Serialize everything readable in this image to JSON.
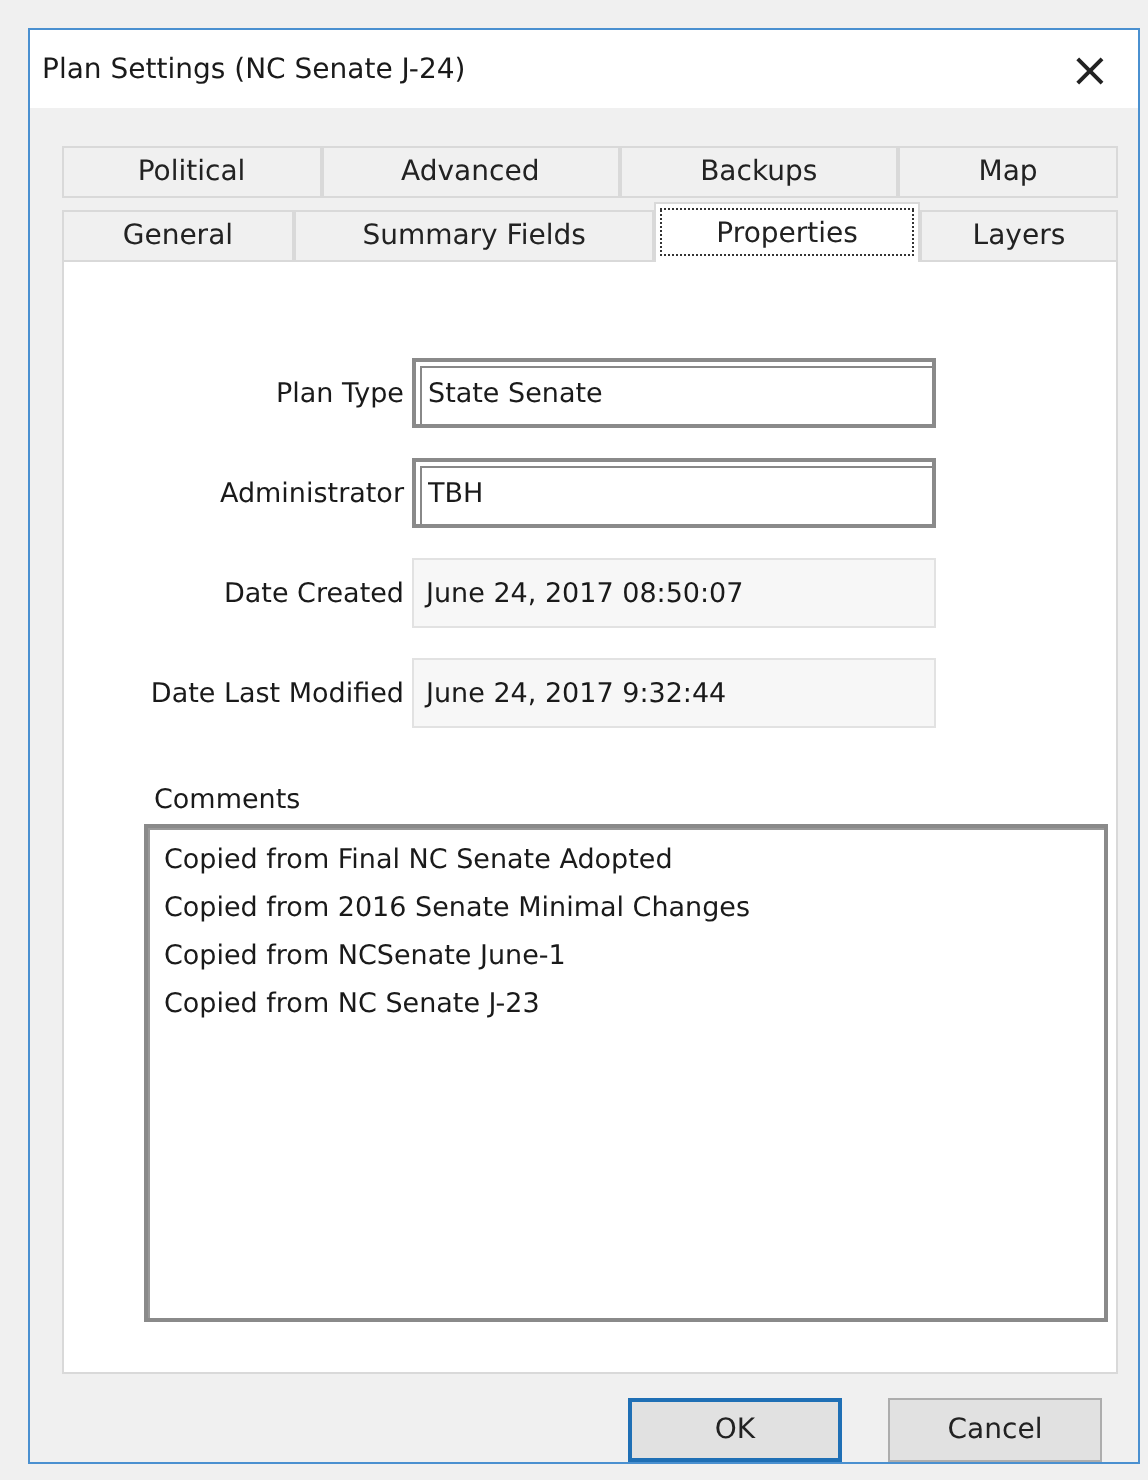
{
  "window": {
    "title": "Plan Settings (NC Senate J-24)",
    "close": "×"
  },
  "tab_rows": [
    [
      {
        "label": "Political",
        "selected": false
      },
      {
        "label": "Advanced",
        "selected": false
      },
      {
        "label": "Backups",
        "selected": false
      },
      {
        "label": "Map",
        "selected": false
      }
    ],
    [
      {
        "label": "General",
        "selected": false
      },
      {
        "label": "Summary Fields",
        "selected": false
      },
      {
        "label": "Properties",
        "selected": true
      },
      {
        "label": "Layers",
        "selected": false
      }
    ]
  ],
  "fields": [
    {
      "label": "Plan Type",
      "value": "State Senate",
      "kind": "editable"
    },
    {
      "label": "Administrator",
      "value": "TBH",
      "kind": "editable"
    },
    {
      "label": "Date Created",
      "value": "June 24, 2017 08:50:07",
      "kind": "readonly"
    },
    {
      "label": "Date Last Modified",
      "value": "June 24, 2017 9:32:44",
      "kind": "readonly"
    }
  ],
  "comments": {
    "label": "Comments",
    "lines": [
      "Copied from Final NC Senate Adopted",
      "Copied from 2016 Senate Minimal Changes",
      "Copied from NCSenate June-1",
      "Copied from NC Senate J-23"
    ]
  },
  "buttons": [
    {
      "label": "OK",
      "default": true
    },
    {
      "label": "Cancel",
      "default": false
    }
  ]
}
